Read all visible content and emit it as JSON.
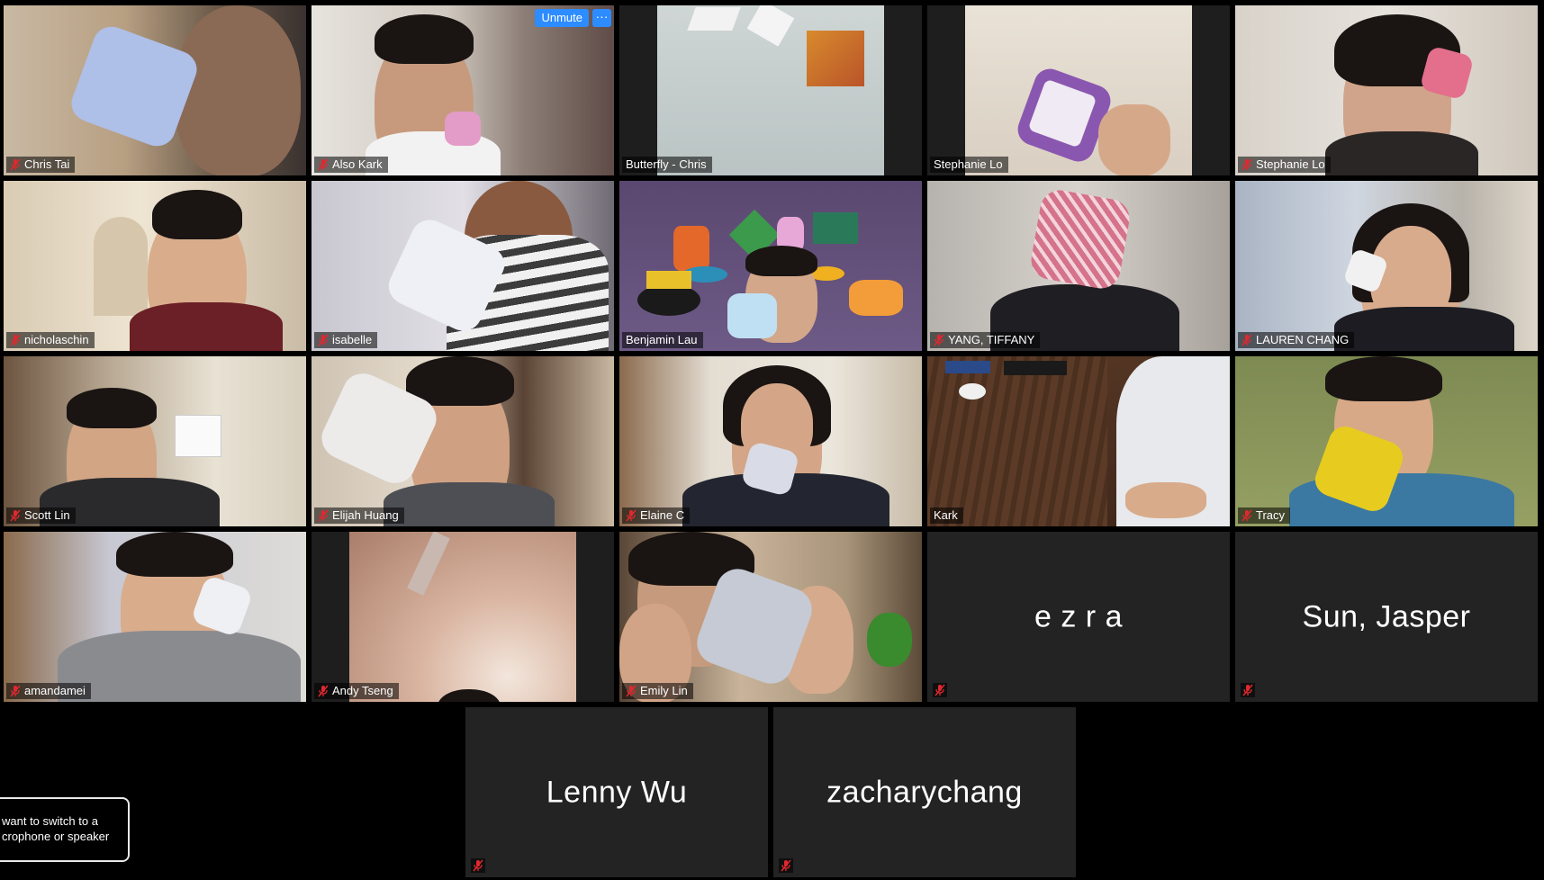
{
  "meeting": {
    "participants": [
      {
        "name": "Chris Tai",
        "muted": true,
        "video": true
      },
      {
        "name": "Also Kark",
        "muted": true,
        "video": true,
        "hover_controls": {
          "unmute_label": "Unmute",
          "more_label": "···"
        }
      },
      {
        "name": "Butterfly - Chris",
        "muted": false,
        "video": true
      },
      {
        "name": "Stephanie Lo",
        "muted": false,
        "video": true
      },
      {
        "name": "Stephanie Lo",
        "muted": true,
        "video": true
      },
      {
        "name": "nicholaschin",
        "muted": true,
        "video": true
      },
      {
        "name": "isabelle",
        "muted": true,
        "video": true
      },
      {
        "name": "Benjamin Lau",
        "muted": false,
        "video": true
      },
      {
        "name": "YANG, TIFFANY",
        "muted": true,
        "video": true
      },
      {
        "name": "LAUREN CHANG",
        "muted": true,
        "video": true
      },
      {
        "name": "Scott Lin",
        "muted": true,
        "video": true
      },
      {
        "name": "Elijah Huang",
        "muted": true,
        "video": true
      },
      {
        "name": "Elaine C",
        "muted": true,
        "video": true
      },
      {
        "name": "Kark",
        "muted": false,
        "video": true,
        "active_speaker": true
      },
      {
        "name": "Tracy",
        "muted": true,
        "video": true
      },
      {
        "name": "amandamei",
        "muted": true,
        "video": true
      },
      {
        "name": "Andy Tseng",
        "muted": true,
        "video": true
      },
      {
        "name": "Emily Lin",
        "muted": true,
        "video": true
      },
      {
        "name": "e z r a",
        "muted": true,
        "video": false
      },
      {
        "name": "Sun, Jasper",
        "muted": true,
        "video": false
      },
      {
        "name": "Lenny Wu",
        "muted": true,
        "video": false
      },
      {
        "name": "zacharychang",
        "muted": true,
        "video": false
      }
    ]
  },
  "toast": {
    "line1": "want to switch to a",
    "line2": "crophone or speaker"
  },
  "colors": {
    "mute_red": "#e0282e",
    "active_border": "#e4e86b",
    "button_blue": "#2d8cff",
    "tile_bg": "#232323"
  },
  "icons": {
    "mute": "muted-mic-icon",
    "more": "ellipsis-icon"
  }
}
